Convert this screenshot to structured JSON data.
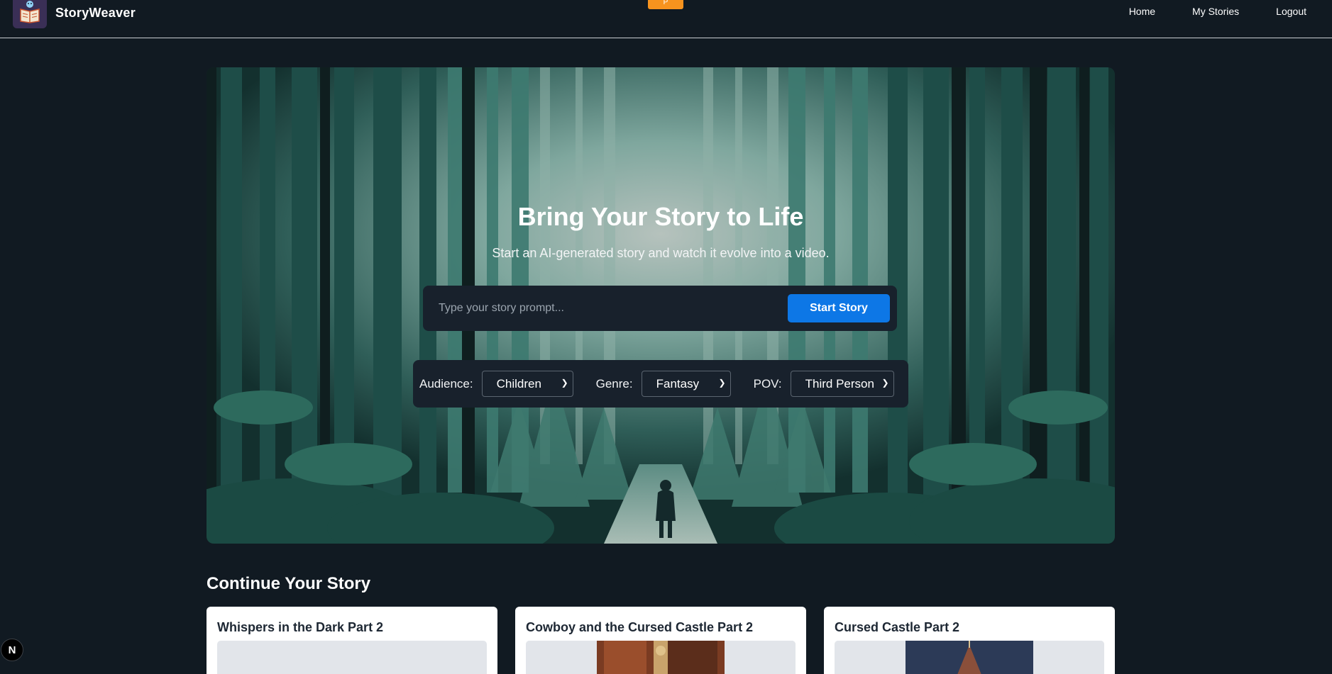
{
  "app": {
    "brand": "StoryWeaver",
    "logo_icon": "open-book-icon",
    "notice_chip": "P"
  },
  "nav": {
    "links": [
      "Home",
      "My Stories",
      "Logout"
    ]
  },
  "hero": {
    "title": "Bring Your Story to Life",
    "subtitle": "Start an AI-generated story and watch it evolve into a video.",
    "prompt_placeholder": "Type your story prompt...",
    "prompt_value": "",
    "start_button": "Start Story"
  },
  "options": {
    "audience": {
      "label": "Audience:",
      "value": "Children"
    },
    "genre": {
      "label": "Genre:",
      "value": "Fantasy"
    },
    "pov": {
      "label": "POV:",
      "value": "Third Person"
    }
  },
  "continue": {
    "title": "Continue Your Story",
    "cards": [
      {
        "title": "Whispers in the Dark Part 2"
      },
      {
        "title": "Cowboy and the Cursed Castle Part 2"
      },
      {
        "title": "Cursed Castle Part 2"
      }
    ]
  },
  "dev_badge": "N",
  "colors": {
    "accent": "#0d77e6",
    "background": "#111a22",
    "notice": "#f7931e"
  }
}
